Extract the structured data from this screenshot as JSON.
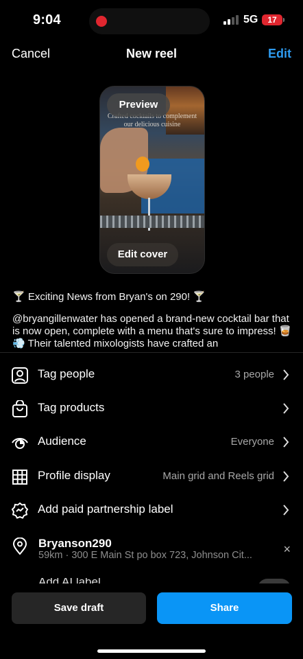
{
  "status_bar": {
    "time": "9:04",
    "network": "5G",
    "battery": "17",
    "battery_level": 0.17,
    "recording_color": "#e0262f"
  },
  "header": {
    "cancel_label": "Cancel",
    "title": "New reel",
    "edit_label": "Edit",
    "accent_color": "#2e9bf0"
  },
  "preview": {
    "preview_label": "Preview",
    "edit_cover_label": "Edit cover",
    "overlay_text": "Crafted cocktails to complement our delicious cuisine"
  },
  "caption": {
    "line1": "🍸 Exciting News from Bryan's on 290! 🍸",
    "body": "@bryangillenwater has opened a brand-new cocktail bar that is now open, complete with a menu that's sure to impress! 🥃💨 Their talented mixologists have crafted an"
  },
  "settings": {
    "tag_people": {
      "label": "Tag people",
      "value": "3 people",
      "icon": "person-tag-icon"
    },
    "tag_products": {
      "label": "Tag products",
      "icon": "shopping-bag-icon"
    },
    "audience": {
      "label": "Audience",
      "value": "Everyone",
      "icon": "audience-eye-icon"
    },
    "profile_display": {
      "label": "Profile display",
      "value": "Main grid and Reels grid",
      "icon": "grid-icon"
    },
    "paid_partnership": {
      "label": "Add paid partnership label",
      "icon": "partnership-icon"
    },
    "location": {
      "name": "Bryanson290",
      "detail": "59km · 300 E Main St po box 723, Johnson Cit...",
      "icon": "location-pin-icon",
      "remove_label": "×"
    },
    "partial_row": "Add AI label"
  },
  "actions": {
    "save_draft_label": "Save draft",
    "share_label": "Share",
    "share_color": "#0a95f6"
  }
}
